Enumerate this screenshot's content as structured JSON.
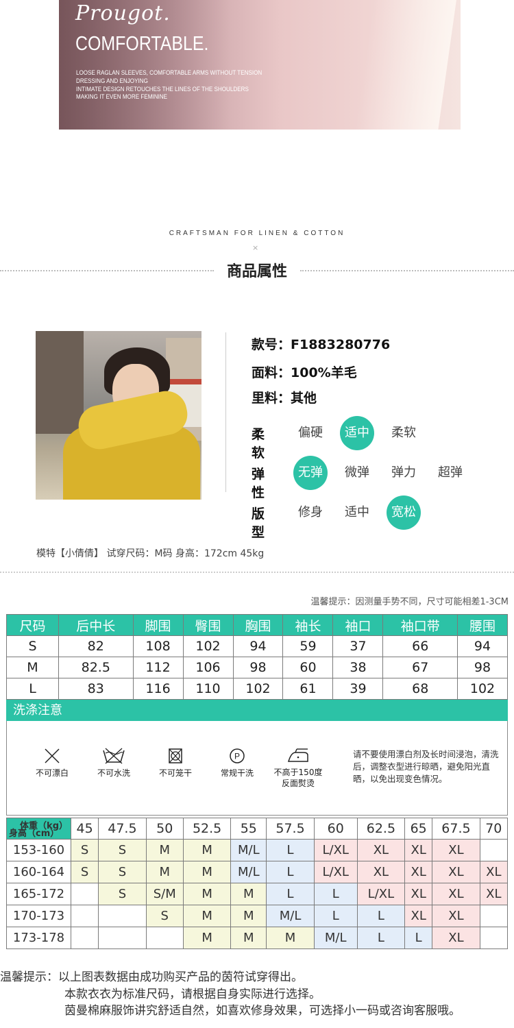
{
  "hero": {
    "script": "Prougot.",
    "headline": "COMFORTABLE.",
    "lines": [
      "LOOSE RAGLAN SLEEVES, COMFORTABLE ARMS WITHOUT TENSION",
      "DRESSING AND ENJOYING",
      "INTIMATE DESIGN RETOUCHES THE LINES OF THE SHOULDERS",
      "MAKING IT EVEN MORE FEMININE"
    ]
  },
  "section": {
    "craft": "CRAFTSMAN FOR LINEN & COTTON",
    "x": "×",
    "title": "商品属性"
  },
  "attributes": {
    "style_no": "款号：F1883280776",
    "fabric": "面料：100%羊毛",
    "lining": "里料：其他"
  },
  "scales": [
    {
      "label": "柔软",
      "options": [
        "偏硬",
        "适中",
        "柔软"
      ],
      "selected": 1
    },
    {
      "label": "弹性",
      "options": [
        "无弹",
        "微弹",
        "弹力",
        "超弹"
      ],
      "selected": 0
    },
    {
      "label": "版型",
      "options": [
        "修身",
        "适中",
        "宽松"
      ],
      "selected": 2
    }
  ],
  "model_note": "模特【小倩倩】 试穿尺码：M码 身高：172cm 45kg",
  "tip": "温馨提示：因测量手势不同，尺寸可能相差1-3CM",
  "size_table": {
    "headers": [
      "尺码",
      "后中长",
      "脚围",
      "臀围",
      "胸围",
      "袖长",
      "袖口",
      "袖口带",
      "腰围"
    ],
    "rows": [
      [
        "S",
        "82",
        "108",
        "102",
        "94",
        "59",
        "37",
        "66",
        "94"
      ],
      [
        "M",
        "82.5",
        "112",
        "106",
        "98",
        "60",
        "38",
        "67",
        "98"
      ],
      [
        "L",
        "83",
        "116",
        "110",
        "102",
        "61",
        "39",
        "68",
        "102"
      ]
    ]
  },
  "wash": {
    "title": "洗涤注意",
    "items": [
      {
        "icon": "no-bleach-icon",
        "label": "不可漂白"
      },
      {
        "icon": "no-wash-icon",
        "label": "不可水洗"
      },
      {
        "icon": "no-tumble-dry-icon",
        "label": "不可笼干"
      },
      {
        "icon": "dry-clean-icon",
        "label": "常规干洗"
      },
      {
        "icon": "iron-icon",
        "label": "不高于150度\n反面熨烫"
      }
    ],
    "note": "请不要使用漂白剂及长时间浸泡，清洗后，调整衣型进行晾晒，避免阳光直晒，以免出现变色情况。"
  },
  "recommend": {
    "corner_weight": "体重（kg）",
    "corner_height": "身高（cm）",
    "weights": [
      "45",
      "47.5",
      "50",
      "52.5",
      "55",
      "57.5",
      "60",
      "62.5",
      "65",
      "67.5",
      "70"
    ],
    "rows": [
      {
        "height": "153-160",
        "sizes": [
          "S",
          "S",
          "M",
          "M",
          "M/L",
          "L",
          "L/XL",
          "XL",
          "XL",
          "XL",
          ""
        ]
      },
      {
        "height": "160-164",
        "sizes": [
          "S",
          "S",
          "M",
          "M",
          "M/L",
          "L",
          "L/XL",
          "XL",
          "XL",
          "XL",
          "XL"
        ]
      },
      {
        "height": "165-172",
        "sizes": [
          "",
          "S",
          "S/M",
          "M",
          "M",
          "L",
          "L",
          "L/XL",
          "XL",
          "XL",
          "XL"
        ]
      },
      {
        "height": "170-173",
        "sizes": [
          "",
          "",
          "S",
          "M",
          "M",
          "M/L",
          "L",
          "L",
          "XL",
          "XL",
          ""
        ]
      },
      {
        "height": "173-178",
        "sizes": [
          "",
          "",
          "",
          "M",
          "M",
          "M",
          "M/L",
          "L",
          "L",
          "XL",
          ""
        ]
      }
    ],
    "colors": {
      "S": "#f6f7dc",
      "M": "#f6f7dc",
      "L": "#e3edf9",
      "XL": "#fbe3e3"
    }
  },
  "footer": {
    "line1": "温馨提示：以上图表数据由成功购买产品的茵符试穿得出。",
    "line2": "本款衣衣为标准尺码，请根据自身实际进行选择。",
    "line3": "茵曼棉麻服饰讲究舒适自然，如喜欢修身效果，可选择小一码或咨询客服哦。"
  }
}
